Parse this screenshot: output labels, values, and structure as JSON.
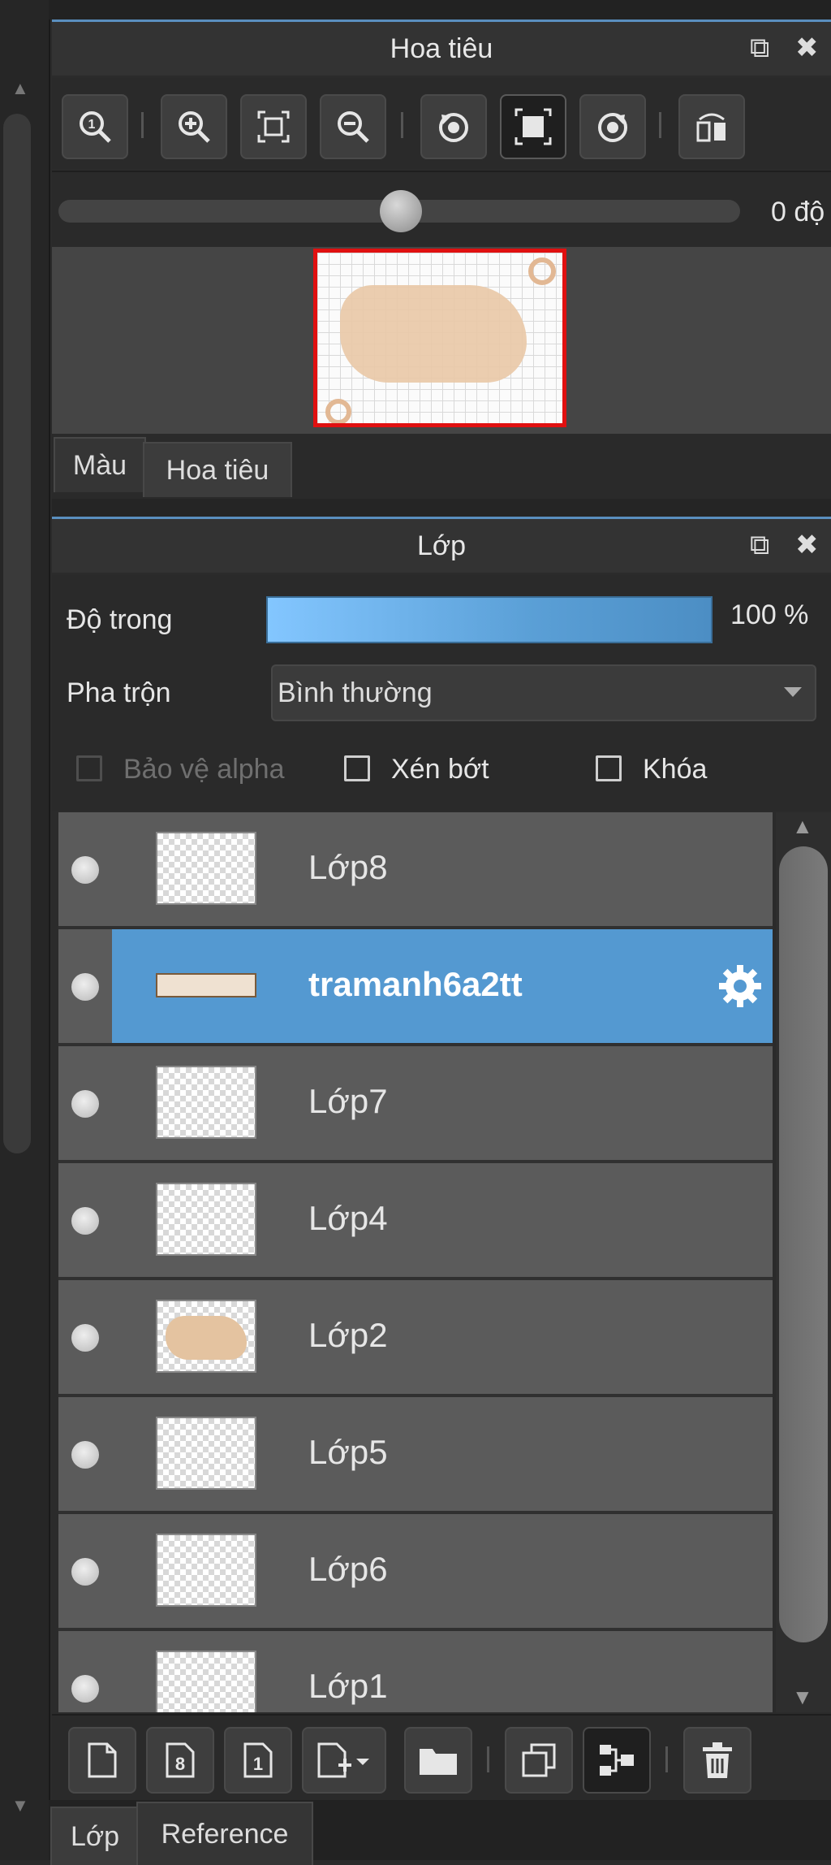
{
  "navigator": {
    "title": "Hoa tiêu",
    "rotation_value": "0 độ",
    "rotation_level": 0.5
  },
  "tabs_top": [
    "Màu",
    "Hoa tiêu"
  ],
  "layers_panel": {
    "title": "Lớp",
    "opacity_label": "Độ trong",
    "opacity_value": "100 %",
    "blend_label": "Pha trộn",
    "blend_value": "Bình thường",
    "protect_alpha": "Bảo vệ alpha",
    "clipping": "Xén bớt",
    "lock": "Khóa",
    "layers": [
      "Lớp8",
      "tramanh6a2tt",
      "Lớp7",
      "Lớp4",
      "Lớp2",
      "Lớp5",
      "Lớp6",
      "Lớp1"
    ],
    "selected_layer": "tramanh6a2tt"
  },
  "tabs_bottom": [
    "Lớp",
    "Reference"
  ],
  "colors": {
    "accent": "#5499d1",
    "preview_border": "#e01010"
  }
}
